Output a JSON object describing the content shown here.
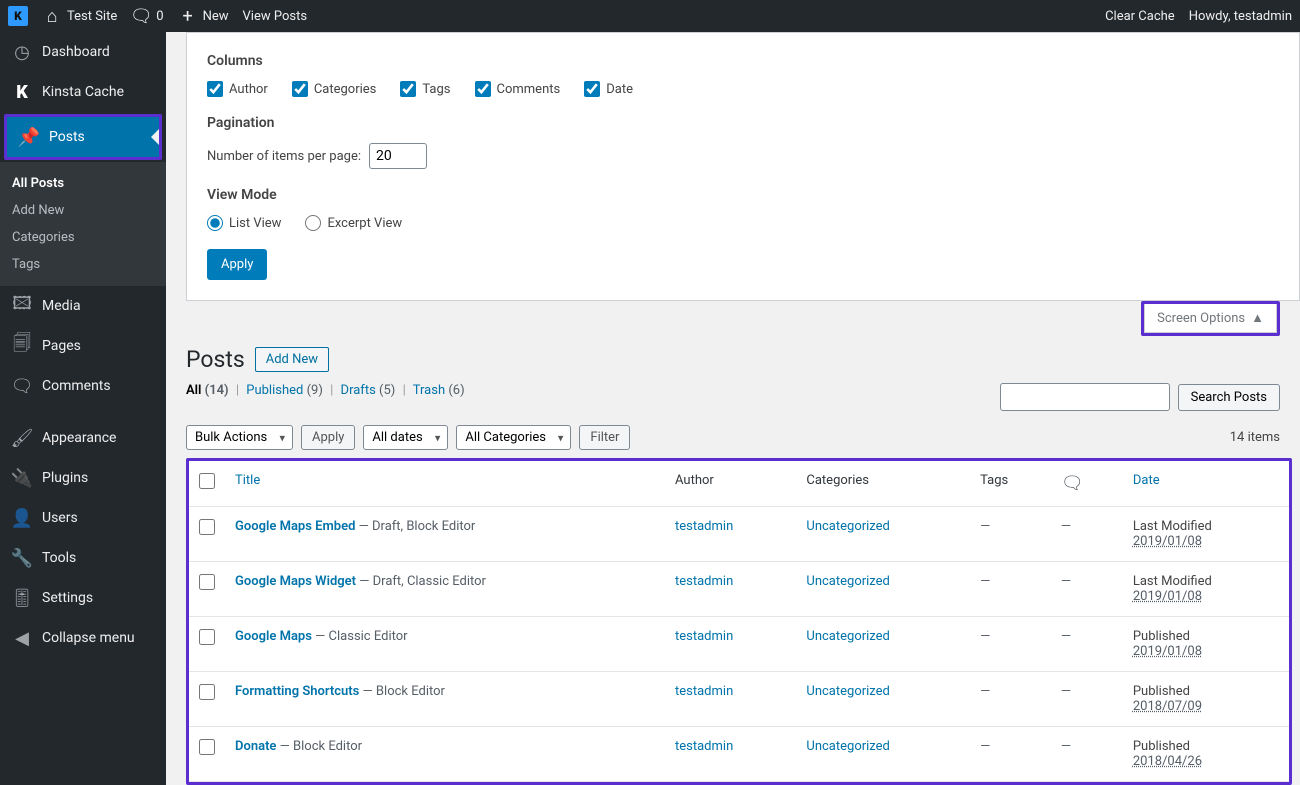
{
  "topbar": {
    "site_name": "Test Site",
    "comments_count": "0",
    "new_label": "New",
    "view_posts_label": "View Posts",
    "clear_cache": "Clear Cache",
    "howdy": "Howdy, testadmin"
  },
  "sidebar": {
    "items": [
      {
        "label": "Dashboard"
      },
      {
        "label": "Kinsta Cache"
      },
      {
        "label": "Posts"
      },
      {
        "label": "Media"
      },
      {
        "label": "Pages"
      },
      {
        "label": "Comments"
      },
      {
        "label": "Appearance"
      },
      {
        "label": "Plugins"
      },
      {
        "label": "Users"
      },
      {
        "label": "Tools"
      },
      {
        "label": "Settings"
      },
      {
        "label": "Collapse menu"
      }
    ],
    "posts_sub": [
      {
        "label": "All Posts",
        "active": true
      },
      {
        "label": "Add New"
      },
      {
        "label": "Categories"
      },
      {
        "label": "Tags"
      }
    ]
  },
  "screen_options": {
    "columns_heading": "Columns",
    "checkboxes": [
      {
        "label": "Author",
        "checked": true
      },
      {
        "label": "Categories",
        "checked": true
      },
      {
        "label": "Tags",
        "checked": true
      },
      {
        "label": "Comments",
        "checked": true
      },
      {
        "label": "Date",
        "checked": true
      }
    ],
    "pagination_heading": "Pagination",
    "per_page_label": "Number of items per page:",
    "per_page_value": "20",
    "view_mode_heading": "View Mode",
    "view_modes": [
      {
        "label": "List View",
        "checked": true
      },
      {
        "label": "Excerpt View",
        "checked": false
      }
    ],
    "apply_label": "Apply",
    "tab_label": "Screen Options"
  },
  "page": {
    "title": "Posts",
    "add_new": "Add New"
  },
  "filters": {
    "all": {
      "label": "All",
      "count": "(14)"
    },
    "published": {
      "label": "Published",
      "count": "(9)"
    },
    "drafts": {
      "label": "Drafts",
      "count": "(5)"
    },
    "trash": {
      "label": "Trash",
      "count": "(6)"
    }
  },
  "tablenav": {
    "bulk_actions": "Bulk Actions",
    "apply": "Apply",
    "all_dates": "All dates",
    "all_categories": "All Categories",
    "filter": "Filter",
    "items_count": "14 items"
  },
  "search": {
    "button": "Search Posts"
  },
  "table": {
    "headers": {
      "title": "Title",
      "author": "Author",
      "categories": "Categories",
      "tags": "Tags",
      "date": "Date"
    },
    "rows": [
      {
        "title": "Google Maps Embed",
        "state": " — Draft, Block Editor",
        "author": "testadmin",
        "category": "Uncategorized",
        "tags": "—",
        "comments": "—",
        "date_status": "Last Modified",
        "date": "2019/01/08"
      },
      {
        "title": "Google Maps Widget",
        "state": " — Draft, Classic Editor",
        "author": "testadmin",
        "category": "Uncategorized",
        "tags": "—",
        "comments": "—",
        "date_status": "Last Modified",
        "date": "2019/01/08"
      },
      {
        "title": "Google Maps",
        "state": " — Classic Editor",
        "author": "testadmin",
        "category": "Uncategorized",
        "tags": "—",
        "comments": "—",
        "date_status": "Published",
        "date": "2019/01/08"
      },
      {
        "title": "Formatting Shortcuts",
        "state": " — Block Editor",
        "author": "testadmin",
        "category": "Uncategorized",
        "tags": "—",
        "comments": "—",
        "date_status": "Published",
        "date": "2018/07/09"
      },
      {
        "title": "Donate",
        "state": " — Block Editor",
        "author": "testadmin",
        "category": "Uncategorized",
        "tags": "—",
        "comments": "—",
        "date_status": "Published",
        "date": "2018/04/26"
      }
    ]
  }
}
